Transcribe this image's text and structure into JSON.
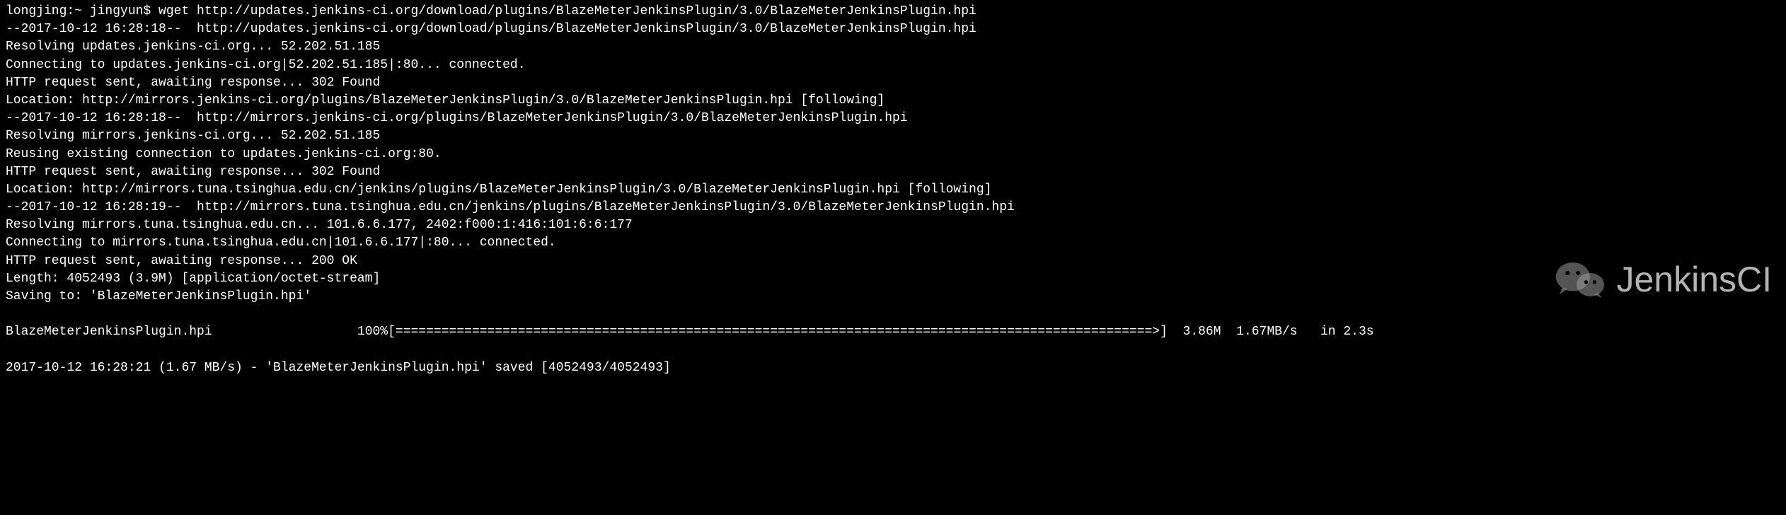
{
  "prompt": "longjing:~ jingyun$ ",
  "command": "wget http://updates.jenkins-ci.org/download/plugins/BlazeMeterJenkinsPlugin/3.0/BlazeMeterJenkinsPlugin.hpi",
  "lines": [
    "--2017-10-12 16:28:18--  http://updates.jenkins-ci.org/download/plugins/BlazeMeterJenkinsPlugin/3.0/BlazeMeterJenkinsPlugin.hpi",
    "Resolving updates.jenkins-ci.org... 52.202.51.185",
    "Connecting to updates.jenkins-ci.org|52.202.51.185|:80... connected.",
    "HTTP request sent, awaiting response... 302 Found",
    "Location: http://mirrors.jenkins-ci.org/plugins/BlazeMeterJenkinsPlugin/3.0/BlazeMeterJenkinsPlugin.hpi [following]",
    "--2017-10-12 16:28:18--  http://mirrors.jenkins-ci.org/plugins/BlazeMeterJenkinsPlugin/3.0/BlazeMeterJenkinsPlugin.hpi",
    "Resolving mirrors.jenkins-ci.org... 52.202.51.185",
    "Reusing existing connection to updates.jenkins-ci.org:80.",
    "HTTP request sent, awaiting response... 302 Found",
    "Location: http://mirrors.tuna.tsinghua.edu.cn/jenkins/plugins/BlazeMeterJenkinsPlugin/3.0/BlazeMeterJenkinsPlugin.hpi [following]",
    "--2017-10-12 16:28:19--  http://mirrors.tuna.tsinghua.edu.cn/jenkins/plugins/BlazeMeterJenkinsPlugin/3.0/BlazeMeterJenkinsPlugin.hpi",
    "Resolving mirrors.tuna.tsinghua.edu.cn... 101.6.6.177, 2402:f000:1:416:101:6:6:177",
    "Connecting to mirrors.tuna.tsinghua.edu.cn|101.6.6.177|:80... connected.",
    "HTTP request sent, awaiting response... 200 OK",
    "Length: 4052493 (3.9M) [application/octet-stream]",
    "Saving to: 'BlazeMeterJenkinsPlugin.hpi'"
  ],
  "progress": {
    "filename": "BlazeMeterJenkinsPlugin.hpi",
    "percent": "100%",
    "bar_open": "[",
    "bar_fill": "===================================================================================================>",
    "bar_close": "]",
    "stats": "  3.86M  1.67MB/s   in 2.3s"
  },
  "summary": "2017-10-12 16:28:21 (1.67 MB/s) - 'BlazeMeterJenkinsPlugin.hpi' saved [4052493/4052493]",
  "watermark": "JenkinsCI"
}
